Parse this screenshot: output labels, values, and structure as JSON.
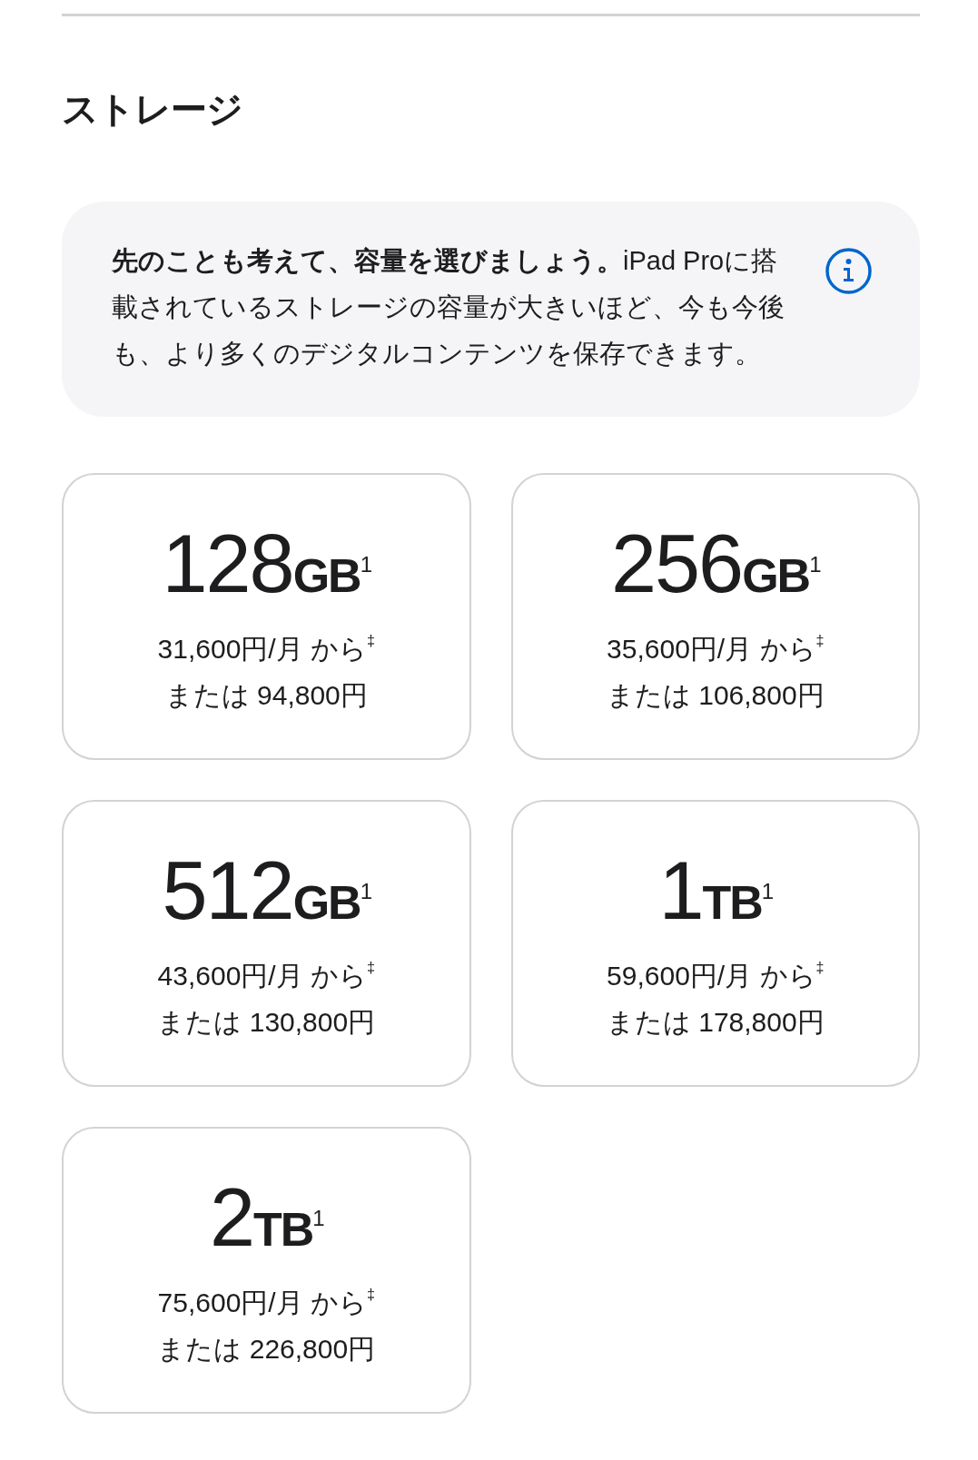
{
  "section": {
    "title": "ストレージ"
  },
  "info": {
    "text": "**先のことも考えて、容量を選びましょう。**iPad Proに搭載されているストレージの容量が大きいほど、今も今後も、より多くのデジタルコンテンツを保存できます。"
  },
  "options": [
    {
      "capacity": "128**GB**$^{1}$",
      "monthly": "31,600円/月 から$^{‡}$",
      "full_price": "または 94,800円",
      "selected": false
    },
    {
      "capacity": "256**GB**$^{1}$",
      "monthly": "35,600円/月 から$^{‡}$",
      "full_price": "または 106,800円",
      "selected": false
    },
    {
      "capacity": "512**GB**$^{1}$",
      "monthly": "43,600円/月 から$^{‡}$",
      "full_price": "または 130,800円",
      "selected": false
    },
    {
      "capacity": "1**TB**$^{1}$",
      "monthly": "59,600円/月 から$^{‡}$",
      "full_price": "または 178,800円",
      "selected": false
    },
    {
      "capacity": "2**TB**$^{1}$",
      "monthly": "75,600円/月 から$^{‡}$",
      "full_price": "または 226,800円",
      "selected": false
    }
  ]
}
